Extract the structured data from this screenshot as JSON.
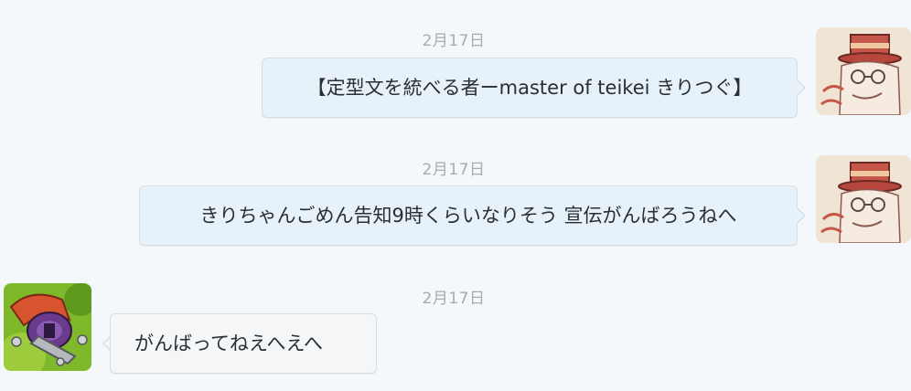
{
  "messages": [
    {
      "timestamp": "2月17日",
      "text": "【定型文を統べる者ーmaster of  teikei きりつぐ】",
      "direction": "sent",
      "avatar_icon": "top-hat-character-icon"
    },
    {
      "timestamp": "2月17日",
      "text": "きりちゃんごめん告知9時くらいなりそう 宣伝がんばろうねへ",
      "direction": "sent",
      "avatar_icon": "top-hat-character-icon"
    },
    {
      "timestamp": "2月17日",
      "text": "がんばってねえへえへ",
      "direction": "received",
      "avatar_icon": "robot-character-icon"
    }
  ],
  "colors": {
    "background": "#f5f8fa",
    "sent_bubble": "#e6f1f9",
    "received_bubble": "#f5f6f7",
    "timestamp": "#a3acb5",
    "text": "#292f33"
  }
}
